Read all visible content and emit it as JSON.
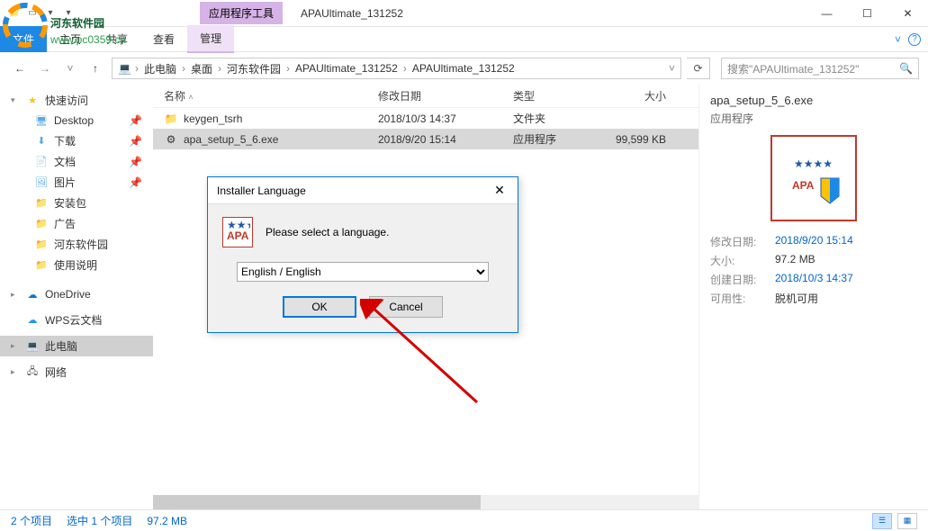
{
  "watermark": {
    "text1": "河东软件园",
    "text2": "www.pc0359.cn"
  },
  "titlebar": {
    "context_tab": "应用程序工具",
    "title": "APAUltimate_131252"
  },
  "ribbon": {
    "tabs": [
      "文件",
      "主页",
      "共享",
      "查看"
    ],
    "context_tab": "管理"
  },
  "breadcrumb": {
    "items": [
      "此电脑",
      "桌面",
      "河东软件园",
      "APAUltimate_131252",
      "APAUltimate_131252"
    ]
  },
  "search": {
    "placeholder": "搜索\"APAUltimate_131252\""
  },
  "sidebar": {
    "quick": "快速访问",
    "items": [
      "Desktop",
      "下载",
      "文档",
      "图片",
      "安装包",
      "广告",
      "河东软件园",
      "使用说明"
    ],
    "onedrive": "OneDrive",
    "wps": "WPS云文档",
    "pc": "此电脑",
    "network": "网络"
  },
  "columns": {
    "name": "名称",
    "date": "修改日期",
    "type": "类型",
    "size": "大小"
  },
  "rows": [
    {
      "name": "keygen_tsrh",
      "date": "2018/10/3 14:37",
      "type": "文件夹",
      "size": "",
      "icon": "folder"
    },
    {
      "name": "apa_setup_5_6.exe",
      "date": "2018/9/20 15:14",
      "type": "应用程序",
      "size": "99,599 KB",
      "icon": "exe"
    }
  ],
  "preview": {
    "filename": "apa_setup_5_6.exe",
    "filetype": "应用程序",
    "meta": [
      {
        "label": "修改日期:",
        "value": "2018/9/20 15:14",
        "link": true
      },
      {
        "label": "大小:",
        "value": "97.2 MB",
        "link": false
      },
      {
        "label": "创建日期:",
        "value": "2018/10/3 14:37",
        "link": true
      },
      {
        "label": "可用性:",
        "value": "脱机可用",
        "link": false
      }
    ]
  },
  "status": {
    "count": "2 个项目",
    "selected": "选中 1 个项目",
    "size": "97.2 MB"
  },
  "dialog": {
    "title": "Installer Language",
    "prompt": "Please select a language.",
    "selected_option": "English / English",
    "ok": "OK",
    "cancel": "Cancel"
  }
}
